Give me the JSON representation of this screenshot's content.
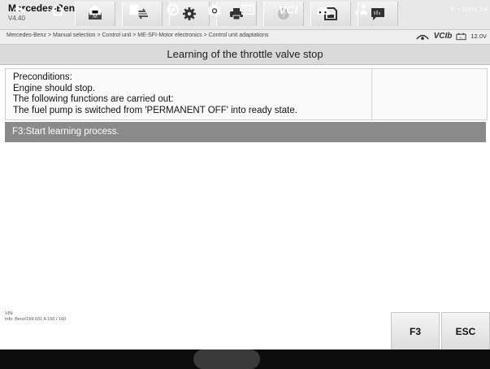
{
  "app": {
    "name": "Mercedes-Benz",
    "version": "V4.40"
  },
  "toolbar": {
    "items": [
      {
        "icon": "home-icon"
      },
      {
        "icon": "vehicle-swap-icon"
      },
      {
        "icon": "settings-gear-icon"
      },
      {
        "icon": "print-icon"
      },
      {
        "icon": "help-icon"
      },
      {
        "icon": "save-icon"
      },
      {
        "icon": "data-logging-icon"
      }
    ]
  },
  "breadcrumb": "Mercedes-Benz > Manual selection > Control unit > ME-SFI-Motor electronics > Control unit adaptations",
  "status": {
    "vci_label": "VCIb",
    "voltage": "12.0V"
  },
  "page_title": "Learning of the throttle valve stop",
  "description": {
    "line1": "Preconditions:",
    "line2": "Engine should stop.",
    "line3": "The following functions are carried out:",
    "line4": "The fuel pump is switched from 'PERMANENT OFF' into ready state."
  },
  "selected_row": "F3:Start learning process.",
  "info": {
    "vin_label": "VIN:",
    "info_line": "Info: Benz/169.031 A 150 / 160"
  },
  "function_buttons": {
    "f3": "F3",
    "esc": "ESC"
  },
  "navbar": {
    "vci_text": "VCI",
    "system_status": "100% 2:4"
  }
}
